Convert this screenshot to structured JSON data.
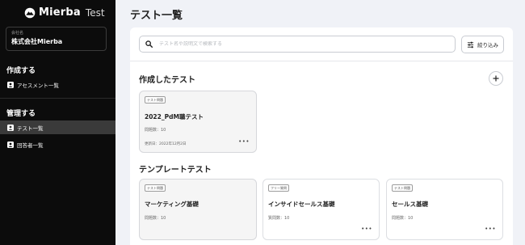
{
  "brand": {
    "name": "Mierba",
    "suffix": "Test",
    "logo_icon": "mountain-logo-icon"
  },
  "company": {
    "label": "会社名",
    "name": "株式会社Mierba"
  },
  "sidebar": {
    "create_heading": "作成する",
    "manage_heading": "管理する",
    "items": [
      {
        "label": "アセスメント一覧",
        "icon": "user-icon",
        "active": false
      },
      {
        "label": "テスト一覧",
        "icon": "user-icon",
        "active": true
      },
      {
        "label": "回答者一覧",
        "icon": "user-icon",
        "active": false
      }
    ]
  },
  "main": {
    "page_title": "テスト一覧",
    "search": {
      "placeholder": "テスト名や説明文で検索する",
      "value": ""
    },
    "filter_label": "絞り込み",
    "my_tests_heading": "作成したテスト",
    "template_heading": "テンプレートテスト",
    "my_tests": [
      {
        "badge": "テスト問題",
        "title": "2022_PdM職テスト",
        "meta": "問題数：10",
        "date": "更新日：2022年12月2日",
        "more": "•••"
      }
    ],
    "templates": [
      {
        "badge": "テスト問題",
        "title": "マーケティング基礎",
        "meta": "問題数：10"
      },
      {
        "badge": "フリー質問",
        "title": "インサイドセールス基礎",
        "meta": "質問数：10",
        "more": "•••"
      },
      {
        "badge": "テスト問題",
        "title": "セールス基礎",
        "meta": "問題数：10",
        "more": "•••"
      }
    ]
  },
  "colors": {
    "sidebar_bg": "#0c0c0c",
    "active_item": "#3a3a3a",
    "page_bg": "#f0f2f7"
  }
}
